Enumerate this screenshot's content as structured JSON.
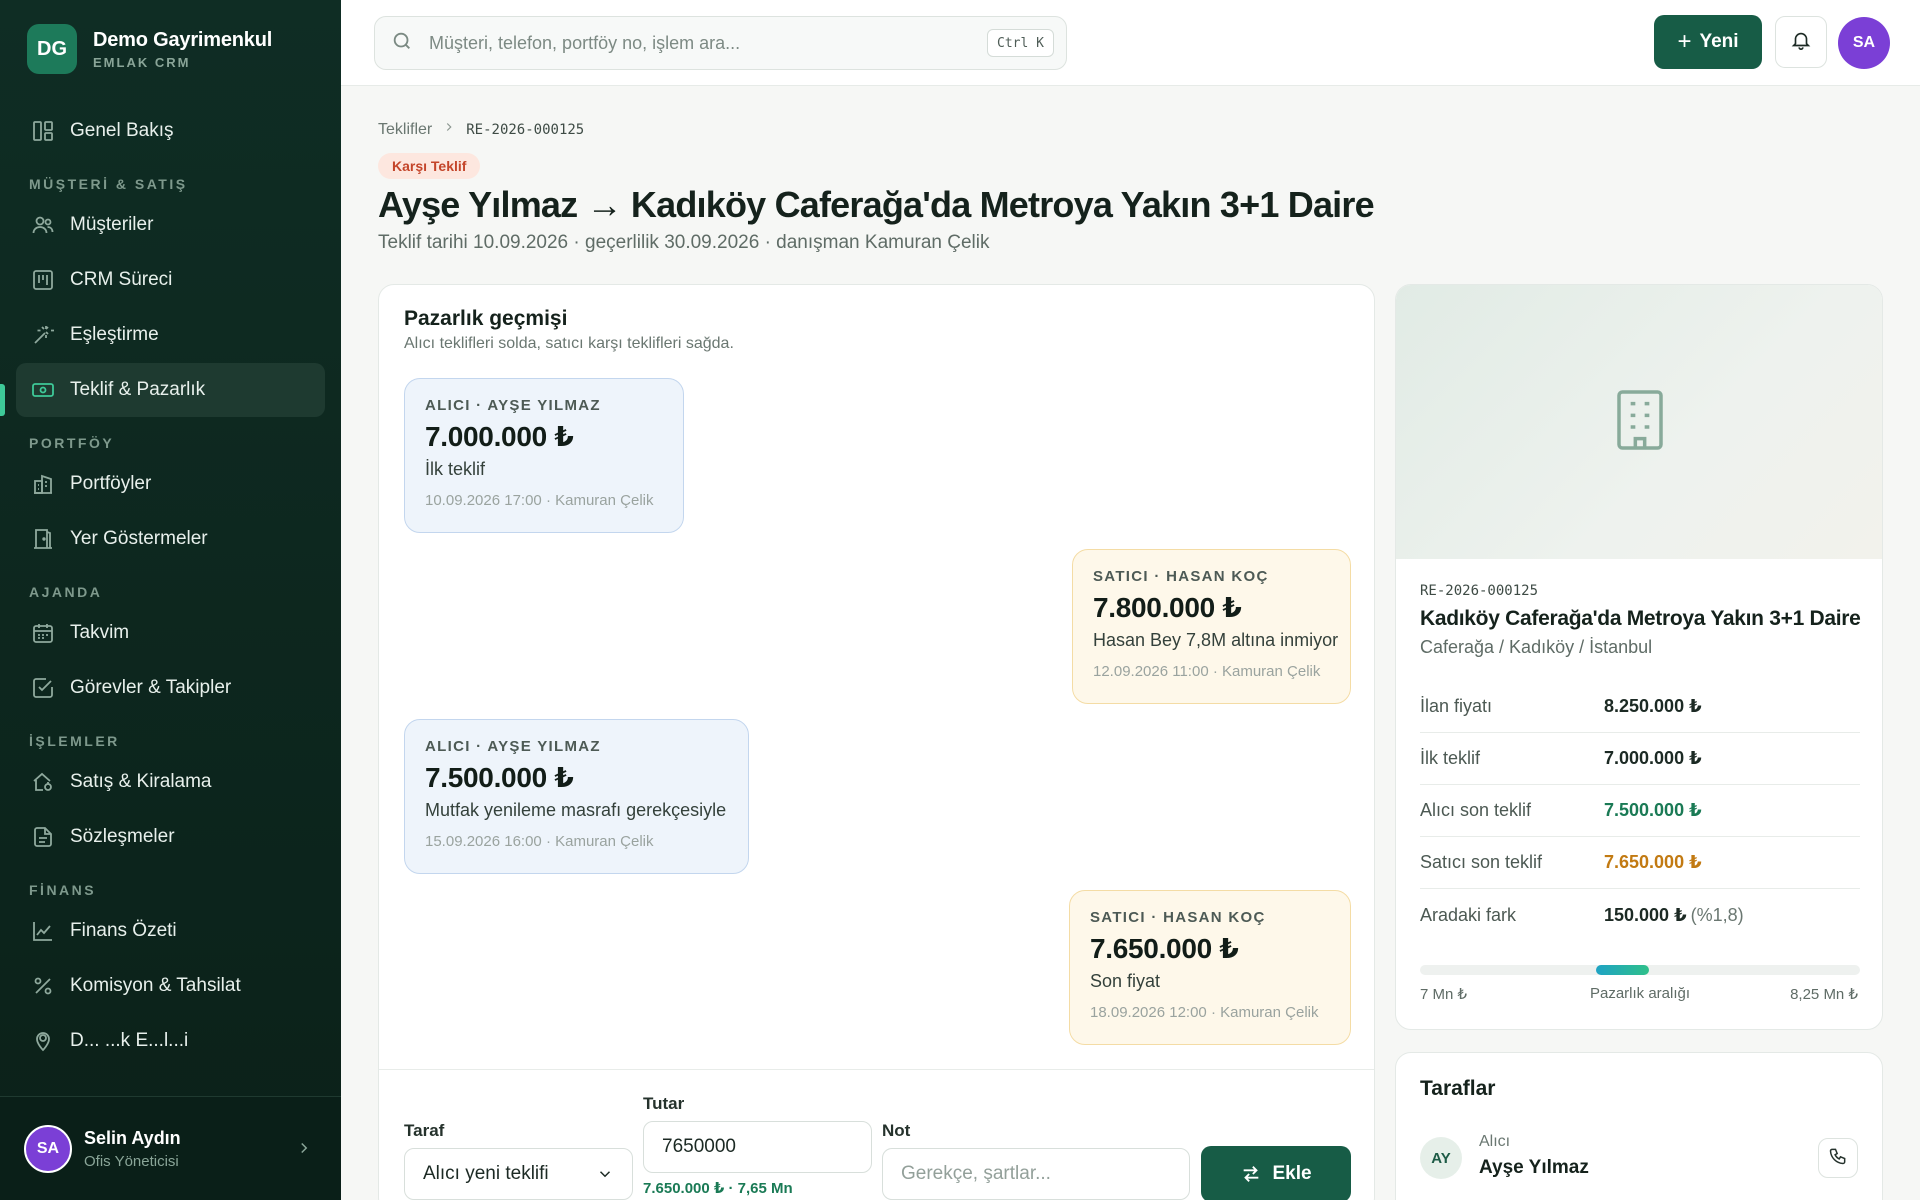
{
  "brand": {
    "initials": "DG",
    "name": "Demo Gayrimenkul",
    "sub": "EMLAK CRM"
  },
  "sidebar": {
    "overview": "Genel Bakış",
    "sections": {
      "sales": "MÜŞTERİ & SATIŞ",
      "portfolio": "PORTFÖY",
      "agenda": "AJANDA",
      "operations": "İŞLEMLER",
      "finance": "FİNANS"
    },
    "items": {
      "customers": "Müşteriler",
      "crm": "CRM Süreci",
      "matching": "Eşleştirme",
      "offers": "Teklif & Pazarlık",
      "portfolios": "Portföyler",
      "showings": "Yer Göstermeler",
      "calendar": "Takvim",
      "tasks": "Görevler & Takipler",
      "sales_rentals": "Satış & Kiralama",
      "contracts": "Sözleşmeler",
      "finance_summary": "Finans Özeti",
      "commission": "Komisyon & Tahsilat",
      "partial": "D... ...k E...l...i"
    }
  },
  "user": {
    "initials": "SA",
    "name": "Selin Aydın",
    "role": "Ofis Yöneticisi"
  },
  "topbar": {
    "search_placeholder": "Müşteri, telefon, portföy no, işlem ara...",
    "shortcut": "Ctrl K",
    "new_label": "Yeni",
    "avatar": "SA"
  },
  "header": {
    "breadcrumb_parent": "Teklifler",
    "breadcrumb_code": "RE-2026-000125",
    "status": "Karşı Teklif",
    "title": "Ayşe Yılmaz → Kadıköy Caferağa'da Metroya Yakın 3+1 Daire",
    "subtitle": "Teklif tarihi 10.09.2026 · geçerlilik 30.09.2026 · danışman Kamuran Çelik"
  },
  "history": {
    "title": "Pazarlık geçmişi",
    "desc": "Alıcı teklifleri solda, satıcı karşı teklifleri sağda.",
    "offers": [
      {
        "side": "buyer",
        "party": "ALICI · AYŞE YILMAZ",
        "amount": "7.000.000 ₺",
        "note": "İlk teklif",
        "meta": "10.09.2026 17:00 · Kamuran Çelik"
      },
      {
        "side": "seller",
        "party": "SATICI · HASAN KOÇ",
        "amount": "7.800.000 ₺",
        "note": "Hasan Bey 7,8M altına inmiyor",
        "meta": "12.09.2026 11:00 · Kamuran Çelik"
      },
      {
        "side": "buyer",
        "party": "ALICI · AYŞE YILMAZ",
        "amount": "7.500.000 ₺",
        "note": "Mutfak yenileme masrafı gerekçesiyle",
        "meta": "15.09.2026 16:00 · Kamuran Çelik"
      },
      {
        "side": "seller",
        "party": "SATICI · HASAN KOÇ",
        "amount": "7.650.000 ₺",
        "note": "Son fiyat",
        "meta": "18.09.2026 12:00 · Kamuran Çelik"
      }
    ]
  },
  "form": {
    "party_label": "Taraf",
    "party_value": "Alıcı yeni teklifi",
    "amount_label": "Tutar",
    "amount_value": "7650000",
    "amount_hint": "7.650.000 ₺ · 7,65 Mn",
    "note_label": "Not",
    "note_placeholder": "Gerekçe, şartlar...",
    "add_label": "Ekle"
  },
  "property": {
    "code": "RE-2026-000125",
    "title": "Kadıköy Caferağa'da Metroya Yakın 3+1 Daire",
    "location": "Caferağa / Kadıköy / İstanbul",
    "rows": [
      {
        "label": "İlan fiyatı",
        "value": "8.250.000 ₺"
      },
      {
        "label": "İlk teklif",
        "value": "7.000.000 ₺"
      },
      {
        "label": "Alıcı son teklif",
        "value": "7.500.000 ₺"
      },
      {
        "label": "Satıcı son teklif",
        "value": "7.650.000 ₺"
      },
      {
        "label": "Aradaki fark",
        "value": "150.000 ₺",
        "extra": "(%1,8)"
      }
    ],
    "range": {
      "min_label": "7 Mn ₺",
      "mid_label": "Pazarlık aralığı",
      "max_label": "8,25 Mn ₺",
      "min": 7000000,
      "max": 8250000,
      "low": 7500000,
      "high": 7650000
    }
  },
  "parties": {
    "title": "Taraflar",
    "buyer": {
      "initials": "AY",
      "role": "Alıcı",
      "name": "Ayşe Yılmaz"
    }
  },
  "colors": {
    "sidebar": "#0f2d24",
    "accent": "#175c46",
    "active": "#3ec998",
    "badge": "#c4452a",
    "buyer": "#eef4fb",
    "seller": "#fef8ea"
  }
}
